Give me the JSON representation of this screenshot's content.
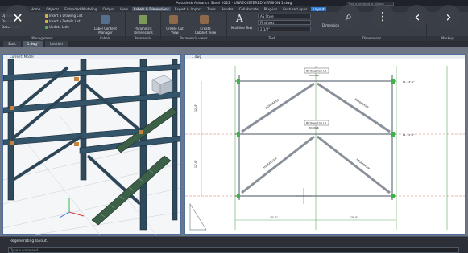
{
  "window": {
    "title": "Autodesk Advance Steel 2022 - UNREGISTERED VERSION    1.dwg",
    "search_placeholder": "Type a keyword or phrase"
  },
  "ribbon_tabs": [
    "Home",
    "Objects",
    "Extended Modeling",
    "Output",
    "View",
    "Labels & Dimensions",
    "Export & Import",
    "Tools",
    "Render",
    "Collaborate",
    "Plug-ins",
    "Featured Apps",
    "Layout"
  ],
  "active_tab": "Labels & Dimensions",
  "overlay": {
    "close": "✕",
    "lens": "⌕",
    "more": "⋮",
    "prev": "‹",
    "next": "›"
  },
  "panels": {
    "management": {
      "title": "Management",
      "items": [
        "Insert a Drawing List",
        "Insert a Details List",
        "Update Lists"
      ],
      "side": [
        "Update",
        "Details",
        "Documents"
      ]
    },
    "labels": {
      "title": "Labels",
      "item": "Label Content Manager"
    },
    "parametric": {
      "title": "Parametric Dimensions",
      "item": "Parametric Dimensions"
    },
    "views": {
      "title": "Parametric views",
      "items": [
        "Create Cut View",
        "Create Cabinet View"
      ]
    },
    "text": {
      "title": "Text",
      "multiline": "Multiline Text",
      "style_value": "AS Style",
      "height_value": "2 1/2\"",
      "find_placeholder": "Find text"
    },
    "dimensions": {
      "title": "Dimensions",
      "item": "Dimension"
    },
    "markup": {
      "title": "Markup"
    }
  },
  "doc_tabs": [
    "Start",
    "1.dwg*",
    "Untitled"
  ],
  "left_viewport": {
    "title": "Current: Model"
  },
  "right_viewport": {
    "title": "1.dwg"
  },
  "drawing": {
    "top_beam_label": "Birdcap top L3",
    "top_beam_sub": "W10X26",
    "mid_beam_label": "Birdcap top L2",
    "mid_beam_sub": "W10X26",
    "diag_upper_left": "HSS6X6X3/8",
    "diag_upper_right": "HSS6X6X3/8",
    "diag_lower_left": "HSS6X6X3/8",
    "diag_lower_right": "HSS6X6X3/8",
    "dim_bottom_left": "10'-0\"",
    "dim_bottom_right": "10'-0\"",
    "dim_left_upper": "12'-0\"",
    "dim_left_lower": "12'-0\"",
    "elev_top": "EL. 24'-0\"",
    "elev_mid": "EL. 12'-0\""
  },
  "command": {
    "history": "Regenerating layout.",
    "placeholder": "Type a command"
  }
}
